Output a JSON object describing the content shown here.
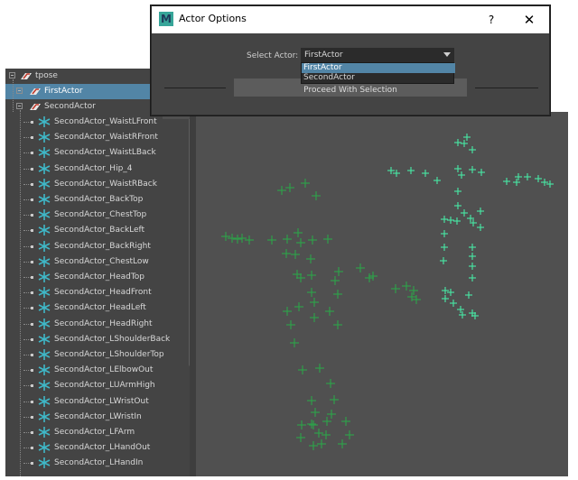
{
  "dialog": {
    "title": "Actor Options",
    "app_logo_letter": "M",
    "help_glyph": "?",
    "close_glyph": "✕",
    "select_label": "Select Actor:",
    "select_value": "FirstActor",
    "options": [
      "FirstActor",
      "SecondActor"
    ],
    "highlighted_option": "FirstActor",
    "proceed_label": "Proceed With Selection"
  },
  "outliner": {
    "root": "tpose",
    "first_actor": "FirstActor",
    "second_actor": "SecondActor",
    "joints": [
      "SecondActor_WaistLFront",
      "SecondActor_WaistRFront",
      "SecondActor_WaistLBack",
      "SecondActor_Hip_4",
      "SecondActor_WaistRBack",
      "SecondActor_BackTop",
      "SecondActor_ChestTop",
      "SecondActor_BackLeft",
      "SecondActor_BackRight",
      "SecondActor_ChestLow",
      "SecondActor_HeadTop",
      "SecondActor_HeadFront",
      "SecondActor_HeadLeft",
      "SecondActor_HeadRight",
      "SecondActor_LShoulderBack",
      "SecondActor_LShoulderTop",
      "SecondActor_LElbowOut",
      "SecondActor_LUArmHigh",
      "SecondActor_LWristOut",
      "SecondActor_LWristIn",
      "SecondActor_LFArm",
      "SecondActor_LHandOut",
      "SecondActor_LHandIn"
    ]
  },
  "colors": {
    "selected_row": "#5285a6",
    "first_actor_markers": "#2f9e4a",
    "second_actor_markers": "#48e0a0",
    "locator_icon": "#3fb8c8"
  },
  "icons": {
    "locator": "locator-icon",
    "reference": "reference-node-icon",
    "expander": "collapse-icon"
  }
}
